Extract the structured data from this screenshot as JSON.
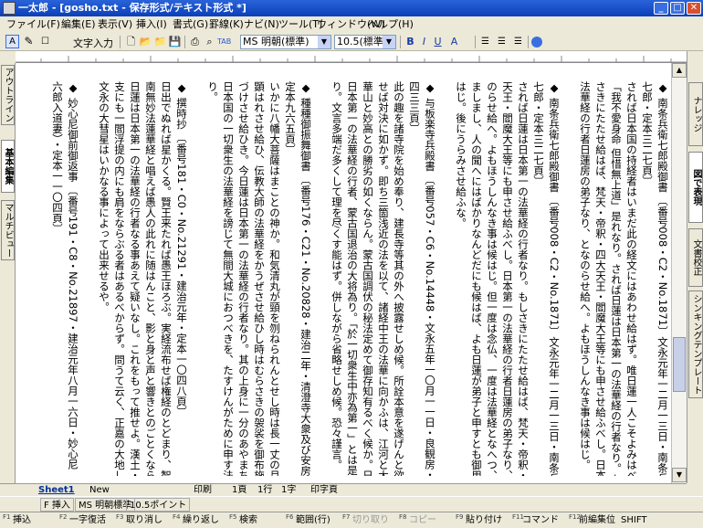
{
  "window": {
    "title": "一太郎 - [gosho.txt - 保存形式/テキスト形式 *]"
  },
  "menu": [
    "ファイル(F)",
    "編集(E)",
    "表示(V)",
    "挿入(I)",
    "書式(G)",
    "罫線(K)",
    "ナビ(N)",
    "ツール(T)",
    "ウィンドウ(W)",
    "ヘルプ(H)"
  ],
  "toolbar": {
    "mode_label": "文字入力",
    "font": "MS 明朝(標準)",
    "size": "10.5(標準)"
  },
  "left_tabs": [
    "アウトライン",
    "基本編集",
    "マルチビュー"
  ],
  "right_tabs": [
    "ナレッジ",
    "図で表現",
    "文書校正",
    "シンキングテンプレート"
  ],
  "document_columns": [
    "◆ 南条兵衛七郎殿御書 〔番号008・C2・No.1871〕文永元年一二月一三日・南条兵衛",
    "七郎・定本三二七頁〕",
    "されば日本国の持経者はいまだ此の経文にはあわせ給はず。唯日蓮一人こそよみはべれ。",
    "「我不愛身命 但惜無上道」是れなり。されば日蓮は日本第一の法華経の行者なり。もし",
    "さきにたたせ給はば、梵天・帝釈・四大天王・閻魔大王等にも申させ給ふべし。日本第一の",
    "法華経の行者日蓮房の弟子なり、となのらせ給へ。よもほうしんなき事は候はじ。",
    "",
    "◆ 南条兵衛七郎殿御書 〔番号008・C2・No.1871〕文永元年一二月一三日・南条兵衛",
    "七郎・定本三二七頁〕",
    "されば日蓮は日本第一の法華経の行者なり。もしさきにたたせ給はば、梵天・帝釈・四大",
    "天王・閻魔大王等にも申させ給ふべし。日本第一の法華経の行者日蓮房の弟子なり、とな",
    "のらせ給へ。よもほうしんなき事は候はじ。但一度は念仏、一度は法華経となへつ、二心",
    "ましまし、人の聞へにはばかりなんどだにも候はば、よも日蓮が弟子と申すとも御用ゐ候",
    "はじ。後にうらみさせ給ふな。",
    "",
    "◆ 与板楽寺兵殿書 〔番号057・C6・No.14448・文永五年一〇月一一日・良観房・定本",
    "四三三頁〕",
    "此の趣を諸寺院を始め奉り、建長寺等其の外へ披露せしめ候。所詮本意を遂げんと欲",
    "せば対決に如かず。即ち三箇浅近の法を以て、諸経中王の法華に向かふは、江河と大海と",
    "華山と妙高との勝劣の如くならん。蒙古国調伏の秘法定めて御存知有るべく候か。日蓮は",
    "日本第一の法華経の行者、蒙古国退治の大将為り。「於一切衆生中亦為第一」とは是れな",
    "り。文言多端だ多くして理を尽くす能はず。併しながら省略せしめ候。恐々謹言。",
    "",
    "◆ 種種御振舞御書 〔番号176・C21・No.20828・建治二年・清澄寺大衆及び安房信徒・",
    "定本九六五頁〕",
    "いかに八幡大菩薩はまことの神か。和気清丸が頸を刎ねられんとせし時は長一丈の月と",
    "顕はれさせ給ひ、伝教大師の法華経をかうぜさせ給ひし時はむらさきの袈裟を御布施にさ",
    "づけさせ給ひき。今日蓮は日本第一の法華経の行者なり。其の上身に一分のあやまちなし。",
    "日本国の一切衆生の法華経を謗じて無間大城におつべきを、たすけんがために申す法門な",
    "り。",
    "",
    "◆ 撰時抄 〔番号181・C0・No.21291・建治元年・定本一〇四八頁〕",
    "日出でぬれば星かくる。賢王来たれば愚王ほろぶ。実経流布せば権経のとどまり、智人",
    "南無妙法蓮華経と唱えば愚人の此れに随はんこと、影と身と声と響きとのごとくならん。",
    "日蓮は日本第一の法華経の行者なる事あえて疑いなし。これをもって推せよ。漢土・月",
    "支にも一閻浮提の内にも肩をならぶる者はあるべからず。問うて云く、正嘉の大地しん・",
    "文永の大彗星はいかなる事によって出来せるや。",
    "",
    "◆ 妙心尼御前御返事 〔番号191・C8・No.21897・建治元年八月一六日・妙心尼（高橋",
    "六郎入道妻）・定本一一〇四頁〕"
  ],
  "bottom": {
    "sheet": "Sheet1",
    "new": "New",
    "print": "印刷",
    "page": "1頁",
    "line": "1行",
    "char": "1字",
    "print_preview": "印字頁"
  },
  "status": {
    "mode": "F 挿入",
    "font": "MS 明朝標準",
    "size": "10.5ポイント"
  },
  "fkeys": [
    {
      "n": "F1",
      "label": "挿込"
    },
    {
      "n": "F2",
      "label": "一字復活"
    },
    {
      "n": "F3",
      "label": "取り消し"
    },
    {
      "n": "F4",
      "label": "繰り返し"
    },
    {
      "n": "F5",
      "label": "検索"
    },
    {
      "n": "F6",
      "label": "範囲(行)"
    },
    {
      "n": "F7",
      "label": "切り取り"
    },
    {
      "n": "F8",
      "label": "コピー"
    },
    {
      "n": "F9",
      "label": "貼り付け"
    },
    {
      "n": "F11",
      "label": "コマンド履歴"
    },
    {
      "n": "F12",
      "label": "前編集位置"
    },
    {
      "n": "",
      "label": "SHIFT"
    }
  ]
}
